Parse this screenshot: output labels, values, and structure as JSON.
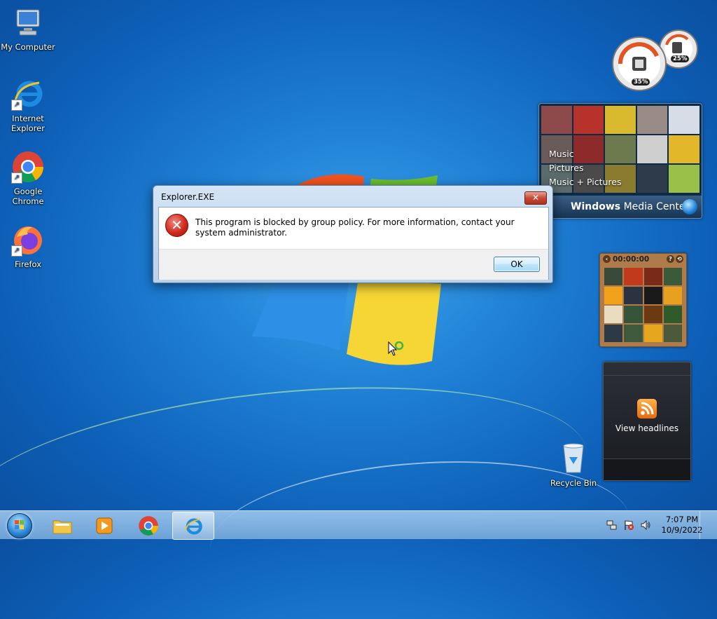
{
  "desktop": {
    "icons": [
      {
        "label": "My Computer",
        "icon": "computer-icon"
      },
      {
        "label": "Internet Explorer",
        "icon": "internet-explorer-icon"
      },
      {
        "label": "Google Chrome",
        "icon": "chrome-icon"
      },
      {
        "label": "Firefox",
        "icon": "firefox-icon"
      },
      {
        "label": "Recycle Bin",
        "icon": "recycle-bin-icon"
      }
    ]
  },
  "gadgets": {
    "cpu_meter": {
      "cpu": "35%",
      "memory": "25%"
    },
    "media_center": {
      "menu": [
        "Music",
        "Pictures",
        "Music + Pictures"
      ],
      "brand_bold": "Windows",
      "brand_rest": " Media Center"
    },
    "puzzle": {
      "timer": "00:00:00"
    },
    "feed": {
      "label": "View headlines"
    }
  },
  "dialog": {
    "title": "Explorer.EXE",
    "close_label": "✕",
    "message": "This program is blocked by group policy. For more information, contact your system administrator.",
    "ok_label": "OK"
  },
  "taskbar": {
    "apps": [
      "folder-icon",
      "media-player-icon",
      "chrome-icon",
      "internet-explorer-icon"
    ],
    "active_app": "internet-explorer-icon",
    "time": "7:07 PM",
    "date": "10/9/2022"
  },
  "colors": {
    "desktop_bg": "#1e7fd4",
    "dialog_title_bg": "#c9dcf1",
    "close_button": "#c74a36",
    "error_red": "#d12a1c"
  }
}
